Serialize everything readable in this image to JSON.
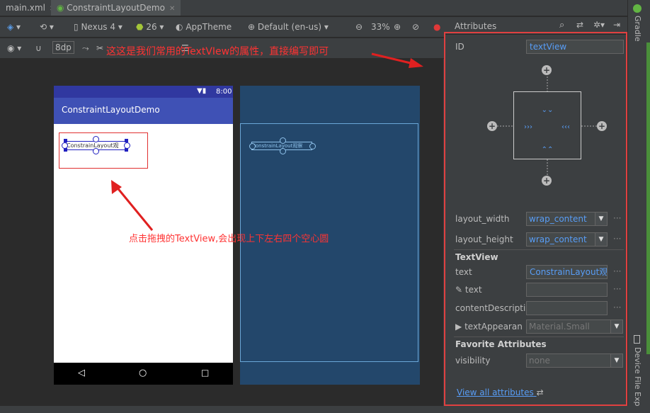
{
  "tabs": [
    {
      "label": "main.xml"
    },
    {
      "label": "ConstraintLayoutDemo"
    }
  ],
  "toolbar": {
    "device": "Nexus 4",
    "api": "26",
    "theme": "AppTheme",
    "locale": "Default (en-us)",
    "zoom": "33%",
    "margin": "8dp"
  },
  "annotations": {
    "top": "这这是我们常用的TextVIew的属性，直接编写即可",
    "middle": "点击拖拽的TextView,会出现上下左右四个空心圆"
  },
  "phone": {
    "status_time": "8:00",
    "app_title": "ConstraintLayoutDemo",
    "widget_text": "ConstrainLayout观",
    "blueprint_text": "ConstrainLayout观察"
  },
  "panel": {
    "title": "Attributes",
    "id_label": "ID",
    "id_value": "textView",
    "layout_width_label": "layout_width",
    "layout_width_value": "wrap_content",
    "layout_height_label": "layout_height",
    "layout_height_value": "wrap_content",
    "section_textview": "TextView",
    "text_label": "text",
    "text_value": "ConstrainLayout观",
    "tools_text_label": "text",
    "tools_text_value": "",
    "content_desc_label": "contentDescripti",
    "content_desc_value": "",
    "text_appearance_label": "textAppearan",
    "text_appearance_value": "Material.Small",
    "section_favorite": "Favorite Attributes",
    "visibility_label": "visibility",
    "visibility_value": "none",
    "view_all": "View all attributes"
  },
  "side": {
    "gradle": "Gradle",
    "device_file": "Device File Explorer"
  }
}
